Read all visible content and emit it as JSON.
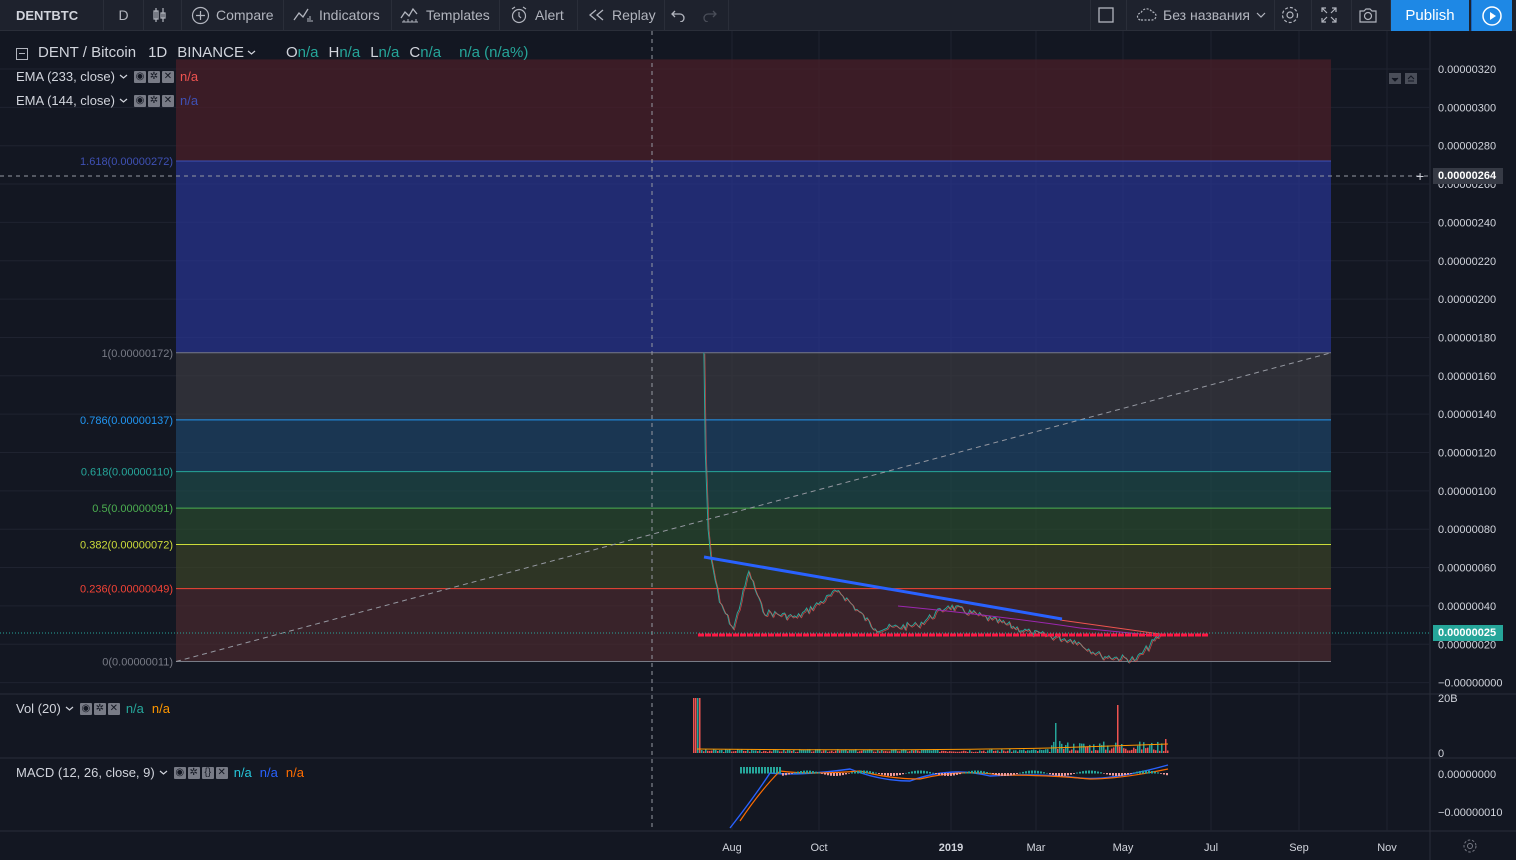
{
  "toolbar": {
    "symbol": "DENTBTC",
    "interval": "D",
    "compare": "Compare",
    "indicators": "Indicators",
    "templates": "Templates",
    "alert": "Alert",
    "replay": "Replay",
    "layout_name": "Без названия",
    "publish": "Publish"
  },
  "legend": {
    "symbol": "DENT / Bitcoin",
    "interval": "1D",
    "exchange": "BINANCE",
    "ohlc": [
      {
        "k": "O",
        "v": "n/a"
      },
      {
        "k": "H",
        "v": "n/a"
      },
      {
        "k": "L",
        "v": "n/a"
      },
      {
        "k": "C",
        "v": "n/a"
      }
    ],
    "change": "n/a (n/a%)",
    "ema1_name": "EMA (233, close)",
    "ema1_value": "n/a",
    "ema2_name": "EMA (144, close)",
    "ema2_value": "n/a",
    "vol_name": "Vol (20)",
    "vol_v1": "n/a",
    "vol_v2": "n/a",
    "macd_name": "MACD (12, 26, close, 9)",
    "macd_v1": "n/a",
    "macd_v2": "n/a",
    "macd_v3": "n/a"
  },
  "colors": {
    "background": "#131722",
    "up": "#26a69a",
    "down": "#ef5350",
    "publish": "#1e88e5",
    "trend_blue": "#2962ff",
    "support_red": "#ff1744"
  },
  "chart_data": {
    "type": "candlestick",
    "price_axis_labels": [
      "0.00000320",
      "0.00000300",
      "0.00000280",
      "0.00000260",
      "0.00000240",
      "0.00000220",
      "0.00000200",
      "0.00000180",
      "0.00000160",
      "0.00000140",
      "0.00000120",
      "0.00000100",
      "0.00000080",
      "0.00000060",
      "0.00000040",
      "0.00000020",
      "−0.00000000"
    ],
    "time_axis_labels": [
      "Aug",
      "Oct",
      "2019",
      "Mar",
      "May",
      "Jul",
      "Sep",
      "Nov"
    ],
    "crosshair_price": "0.00000264",
    "last_price": "0.00000025",
    "fib_levels": [
      {
        "label": "1.618(0.00000272)",
        "price": 2.72e-06,
        "color": "#3f51b5"
      },
      {
        "label": "1(0.00000172)",
        "price": 1.72e-06,
        "color": "#787b86"
      },
      {
        "label": "0.786(0.00000137)",
        "price": 1.37e-06,
        "color": "#2196f3"
      },
      {
        "label": "0.618(0.00000110)",
        "price": 1.1e-06,
        "color": "#26a69a"
      },
      {
        "label": "0.5(0.00000091)",
        "price": 9.1e-07,
        "color": "#4caf50"
      },
      {
        "label": "0.382(0.00000072)",
        "price": 7.2e-07,
        "color": "#cddc39"
      },
      {
        "label": "0.236(0.00000049)",
        "price": 4.9e-07,
        "color": "#f44336"
      },
      {
        "label": "0(0.00000011)",
        "price": 1.1e-07,
        "color": "#787b86"
      }
    ],
    "price_path": [
      {
        "t": "2018-07-11",
        "p": 1.72e-06
      },
      {
        "t": "2018-07-12",
        "p": 1.2e-06
      },
      {
        "t": "2018-07-14",
        "p": 8e-07
      },
      {
        "t": "2018-07-16",
        "p": 6.5e-07
      },
      {
        "t": "2018-07-22",
        "p": 4.2e-07
      },
      {
        "t": "2018-08-01",
        "p": 2.8e-07
      },
      {
        "t": "2018-08-12",
        "p": 5.8e-07
      },
      {
        "t": "2018-08-22",
        "p": 3.7e-07
      },
      {
        "t": "2018-09-15",
        "p": 3.4e-07
      },
      {
        "t": "2018-10-15",
        "p": 4.8e-07
      },
      {
        "t": "2018-11-10",
        "p": 2.8e-07
      },
      {
        "t": "2018-12-10",
        "p": 3e-07
      },
      {
        "t": "2019-01-01",
        "p": 4e-07
      },
      {
        "t": "2019-02-01",
        "p": 3.3e-07
      },
      {
        "t": "2019-03-01",
        "p": 2.6e-07
      },
      {
        "t": "2019-04-01",
        "p": 2.2e-07
      },
      {
        "t": "2019-04-20",
        "p": 1.4e-07
      },
      {
        "t": "2019-05-15",
        "p": 1.2e-07
      },
      {
        "t": "2019-06-01",
        "p": 2.5e-07
      }
    ],
    "vol_axis_labels": [
      "20B",
      "0"
    ],
    "macd_axis_labels": [
      "0.00000000",
      "−0.00000010"
    ]
  }
}
